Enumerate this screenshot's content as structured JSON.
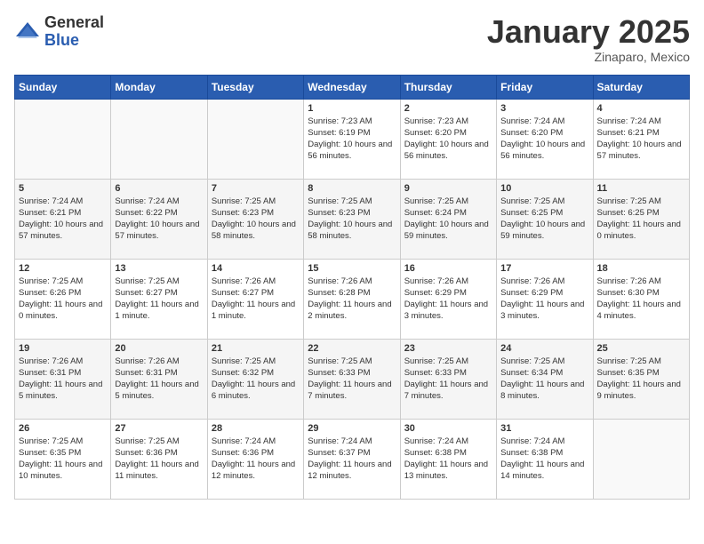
{
  "header": {
    "logo_general": "General",
    "logo_blue": "Blue",
    "month_title": "January 2025",
    "subtitle": "Zinaparo, Mexico"
  },
  "weekdays": [
    "Sunday",
    "Monday",
    "Tuesday",
    "Wednesday",
    "Thursday",
    "Friday",
    "Saturday"
  ],
  "weeks": [
    [
      {
        "day": "",
        "info": ""
      },
      {
        "day": "",
        "info": ""
      },
      {
        "day": "",
        "info": ""
      },
      {
        "day": "1",
        "info": "Sunrise: 7:23 AM\nSunset: 6:19 PM\nDaylight: 10 hours and 56 minutes."
      },
      {
        "day": "2",
        "info": "Sunrise: 7:23 AM\nSunset: 6:20 PM\nDaylight: 10 hours and 56 minutes."
      },
      {
        "day": "3",
        "info": "Sunrise: 7:24 AM\nSunset: 6:20 PM\nDaylight: 10 hours and 56 minutes."
      },
      {
        "day": "4",
        "info": "Sunrise: 7:24 AM\nSunset: 6:21 PM\nDaylight: 10 hours and 57 minutes."
      }
    ],
    [
      {
        "day": "5",
        "info": "Sunrise: 7:24 AM\nSunset: 6:21 PM\nDaylight: 10 hours and 57 minutes."
      },
      {
        "day": "6",
        "info": "Sunrise: 7:24 AM\nSunset: 6:22 PM\nDaylight: 10 hours and 57 minutes."
      },
      {
        "day": "7",
        "info": "Sunrise: 7:25 AM\nSunset: 6:23 PM\nDaylight: 10 hours and 58 minutes."
      },
      {
        "day": "8",
        "info": "Sunrise: 7:25 AM\nSunset: 6:23 PM\nDaylight: 10 hours and 58 minutes."
      },
      {
        "day": "9",
        "info": "Sunrise: 7:25 AM\nSunset: 6:24 PM\nDaylight: 10 hours and 59 minutes."
      },
      {
        "day": "10",
        "info": "Sunrise: 7:25 AM\nSunset: 6:25 PM\nDaylight: 10 hours and 59 minutes."
      },
      {
        "day": "11",
        "info": "Sunrise: 7:25 AM\nSunset: 6:25 PM\nDaylight: 11 hours and 0 minutes."
      }
    ],
    [
      {
        "day": "12",
        "info": "Sunrise: 7:25 AM\nSunset: 6:26 PM\nDaylight: 11 hours and 0 minutes."
      },
      {
        "day": "13",
        "info": "Sunrise: 7:25 AM\nSunset: 6:27 PM\nDaylight: 11 hours and 1 minute."
      },
      {
        "day": "14",
        "info": "Sunrise: 7:26 AM\nSunset: 6:27 PM\nDaylight: 11 hours and 1 minute."
      },
      {
        "day": "15",
        "info": "Sunrise: 7:26 AM\nSunset: 6:28 PM\nDaylight: 11 hours and 2 minutes."
      },
      {
        "day": "16",
        "info": "Sunrise: 7:26 AM\nSunset: 6:29 PM\nDaylight: 11 hours and 3 minutes."
      },
      {
        "day": "17",
        "info": "Sunrise: 7:26 AM\nSunset: 6:29 PM\nDaylight: 11 hours and 3 minutes."
      },
      {
        "day": "18",
        "info": "Sunrise: 7:26 AM\nSunset: 6:30 PM\nDaylight: 11 hours and 4 minutes."
      }
    ],
    [
      {
        "day": "19",
        "info": "Sunrise: 7:26 AM\nSunset: 6:31 PM\nDaylight: 11 hours and 5 minutes."
      },
      {
        "day": "20",
        "info": "Sunrise: 7:26 AM\nSunset: 6:31 PM\nDaylight: 11 hours and 5 minutes."
      },
      {
        "day": "21",
        "info": "Sunrise: 7:25 AM\nSunset: 6:32 PM\nDaylight: 11 hours and 6 minutes."
      },
      {
        "day": "22",
        "info": "Sunrise: 7:25 AM\nSunset: 6:33 PM\nDaylight: 11 hours and 7 minutes."
      },
      {
        "day": "23",
        "info": "Sunrise: 7:25 AM\nSunset: 6:33 PM\nDaylight: 11 hours and 7 minutes."
      },
      {
        "day": "24",
        "info": "Sunrise: 7:25 AM\nSunset: 6:34 PM\nDaylight: 11 hours and 8 minutes."
      },
      {
        "day": "25",
        "info": "Sunrise: 7:25 AM\nSunset: 6:35 PM\nDaylight: 11 hours and 9 minutes."
      }
    ],
    [
      {
        "day": "26",
        "info": "Sunrise: 7:25 AM\nSunset: 6:35 PM\nDaylight: 11 hours and 10 minutes."
      },
      {
        "day": "27",
        "info": "Sunrise: 7:25 AM\nSunset: 6:36 PM\nDaylight: 11 hours and 11 minutes."
      },
      {
        "day": "28",
        "info": "Sunrise: 7:24 AM\nSunset: 6:36 PM\nDaylight: 11 hours and 12 minutes."
      },
      {
        "day": "29",
        "info": "Sunrise: 7:24 AM\nSunset: 6:37 PM\nDaylight: 11 hours and 12 minutes."
      },
      {
        "day": "30",
        "info": "Sunrise: 7:24 AM\nSunset: 6:38 PM\nDaylight: 11 hours and 13 minutes."
      },
      {
        "day": "31",
        "info": "Sunrise: 7:24 AM\nSunset: 6:38 PM\nDaylight: 11 hours and 14 minutes."
      },
      {
        "day": "",
        "info": ""
      }
    ]
  ]
}
